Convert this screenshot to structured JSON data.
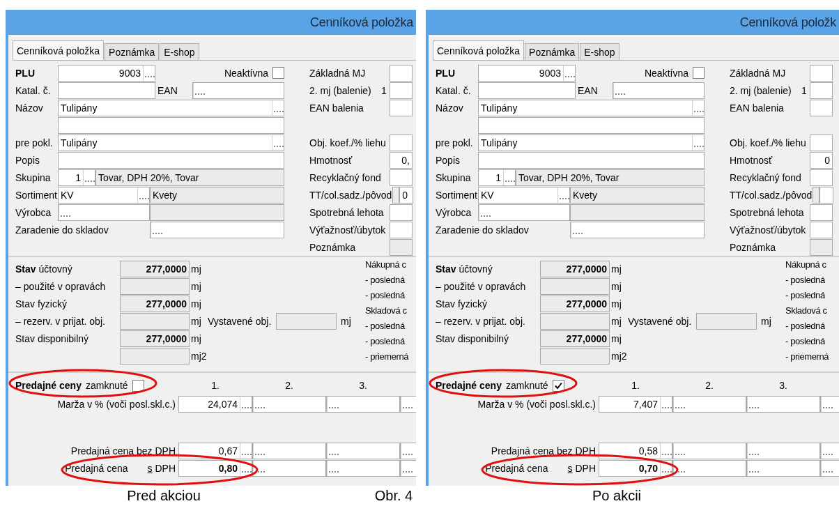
{
  "panels": [
    {
      "title": "Cenníková položka",
      "tabs": [
        {
          "label": "Cenníková položka",
          "selected": true
        },
        {
          "label": "Poznámka",
          "selected": false
        },
        {
          "label": "E-shop",
          "selected": false
        }
      ],
      "general": {
        "plu_label": "PLU",
        "plu_value": "9003",
        "inactive_label": "Neaktívna",
        "inactive_checked": false,
        "catalog_label": "Katal. č.",
        "ean_label": "EAN",
        "name_label": "Názov",
        "name_value": "Tulipány",
        "pos_label": "pre pokl.",
        "pos_value": "Tulipány",
        "description_label": "Popis",
        "group_label": "Skupina",
        "group_value": "1",
        "group_name": "Tovar, DPH 20%, Tovar",
        "assortment_label": "Sortiment",
        "assortment_value": "KV",
        "assortment_name": "Kvety",
        "producer_label": "Výrobca",
        "warehouses_label": "Zaradenie do skladov"
      },
      "units": [
        {
          "kind": "field",
          "label": "Základná MJ"
        },
        {
          "kind": "field",
          "label": "2. mj (balenie)",
          "prefix": "1"
        },
        {
          "kind": "field",
          "label": "EAN balenia"
        },
        {
          "kind": "gap"
        },
        {
          "kind": "field",
          "label": "Obj. koef./% liehu"
        },
        {
          "kind": "field",
          "label": "Hmotnosť",
          "value": "0,"
        },
        {
          "kind": "field",
          "label": "Recyklačný fond"
        },
        {
          "kind": "code",
          "label": "TT/col.sadz./pôvod",
          "value": "0"
        },
        {
          "kind": "field",
          "label": "Spotrebná lehota"
        },
        {
          "kind": "field",
          "label": "Výťažnosť/úbytok"
        },
        {
          "kind": "readonly",
          "label": "Poznámka"
        }
      ],
      "stock": {
        "rows": [
          {
            "label": "**Stav** účtovný",
            "value": "277,0000",
            "unit": "mj"
          },
          {
            "label": "– použité v opravách",
            "unit": "mj"
          },
          {
            "label": "Stav fyzický",
            "value": "277,0000",
            "unit": "mj"
          },
          {
            "label": "– rezerv. v prijat. obj.",
            "unit": "mj"
          },
          {
            "label": "Stav disponibilný",
            "value": "277,0000",
            "unit": "mj"
          },
          {
            "unit": "mj2"
          }
        ],
        "ordered_label": "Vystavené obj.",
        "ordered_unit": "mj",
        "cost_lines": [
          "Nákupná c",
          "- posledná",
          "- posledná",
          "Skladová c",
          "- posledná",
          "- posledná",
          "- priemerná"
        ]
      },
      "prices": {
        "title": "Predajné ceny",
        "locked_label": "zamknuté",
        "locked": false,
        "columns": [
          "1.",
          "2.",
          "3."
        ],
        "rows": [
          {
            "label": "Marža v % (voči posl.skl.c.)",
            "values": [
              "24,074"
            ],
            "bold": false
          },
          {
            "label": "Predajná cena bez DPH",
            "values": [
              "0,67"
            ],
            "bold": false
          },
          {
            "label": "Predajná cena",
            "suffix": "s DPH",
            "values": [
              "0,80"
            ],
            "bold": true
          }
        ]
      }
    },
    {
      "title": "Cenníková položk",
      "tabs": [
        {
          "label": "Cenníková položka",
          "selected": true
        },
        {
          "label": "Poznámka",
          "selected": false
        },
        {
          "label": "E-shop",
          "selected": false
        }
      ],
      "general": {
        "plu_label": "PLU",
        "plu_value": "9003",
        "inactive_label": "Neaktívna",
        "inactive_checked": false,
        "catalog_label": "Katal. č.",
        "ean_label": "EAN",
        "name_label": "Názov",
        "name_value": "Tulipány",
        "pos_label": "pre pokl.",
        "pos_value": "Tulipány",
        "description_label": "Popis",
        "group_label": "Skupina",
        "group_value": "1",
        "group_name": "Tovar, DPH 20%, Tovar",
        "assortment_label": "Sortiment",
        "assortment_value": "KV",
        "assortment_name": "Kvety",
        "producer_label": "Výrobca",
        "warehouses_label": "Zaradenie do skladov"
      },
      "units": [
        {
          "kind": "field",
          "label": "Základná MJ"
        },
        {
          "kind": "field",
          "label": "2. mj (balenie)",
          "prefix": "1"
        },
        {
          "kind": "field",
          "label": "EAN balenia"
        },
        {
          "kind": "gap"
        },
        {
          "kind": "field",
          "label": "Obj. koef./% liehu"
        },
        {
          "kind": "field",
          "label": "Hmotnosť",
          "value": "0"
        },
        {
          "kind": "field",
          "label": "Recyklačný fond"
        },
        {
          "kind": "code",
          "label": "TT/col.sadz./pôvod"
        },
        {
          "kind": "field",
          "label": "Spotrebná lehota"
        },
        {
          "kind": "field",
          "label": "Výťažnosť/úbytok"
        },
        {
          "kind": "readonly",
          "label": "Poznámka"
        }
      ],
      "stock": {
        "rows": [
          {
            "label": "**Stav** účtovný",
            "value": "277,0000",
            "unit": "mj"
          },
          {
            "label": "– použité v opravách",
            "unit": "mj"
          },
          {
            "label": "Stav fyzický",
            "value": "277,0000",
            "unit": "mj"
          },
          {
            "label": "– rezerv. v prijat. obj.",
            "unit": "mj"
          },
          {
            "label": "Stav disponibilný",
            "value": "277,0000",
            "unit": "mj"
          },
          {
            "unit": "mj2"
          }
        ],
        "ordered_label": "Vystavené obj.",
        "ordered_unit": "mj",
        "cost_lines": [
          "Nákupná c",
          "- posledná",
          "- posledná",
          "Skladová c",
          "- posledná",
          "- posledná",
          "- priemerná"
        ]
      },
      "prices": {
        "title": "Predajné ceny",
        "locked_label": "zamknuté",
        "locked": true,
        "columns": [
          "1.",
          "2.",
          "3."
        ],
        "rows": [
          {
            "label": "Marža v % (voči posl.skl.c.)",
            "values": [
              "7,407"
            ],
            "bold": false
          },
          {
            "label": "Predajná cena bez DPH",
            "values": [
              "0,58"
            ],
            "bold": false
          },
          {
            "label": "Predajná cena",
            "suffix": "s DPH",
            "values": [
              "0,70"
            ],
            "bold": true
          }
        ]
      }
    }
  ],
  "captions": [
    "Pred akciou",
    "Obr. 4",
    "Po akcii"
  ]
}
